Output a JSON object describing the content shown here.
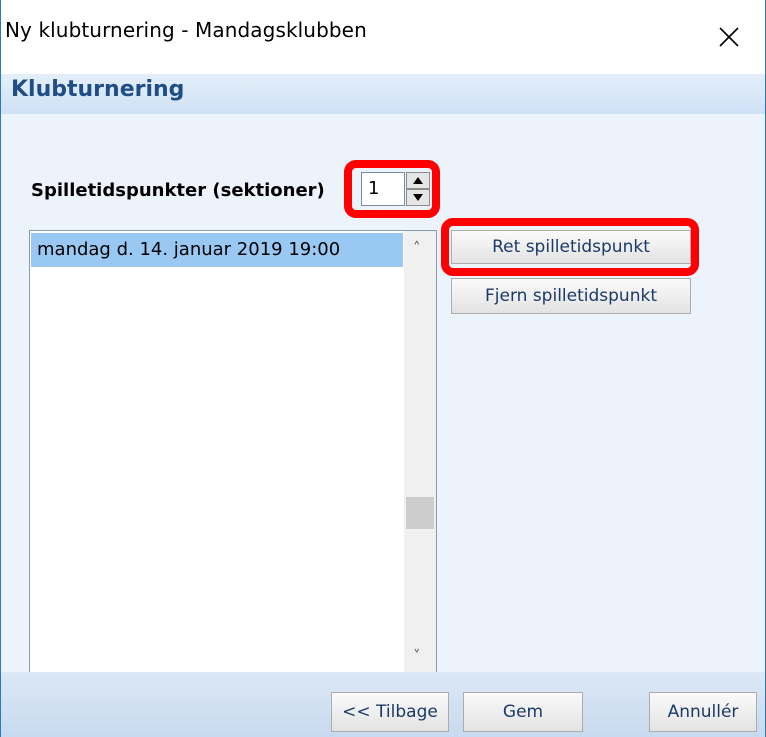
{
  "window": {
    "title": "Ny klubturnering - Mandagsklubben",
    "close_icon": "close-icon"
  },
  "header": {
    "title": "Klubturnering"
  },
  "sections": {
    "label": "Spilletidspunkter (sektioner)",
    "count": "1"
  },
  "schedule_list": {
    "items": [
      "mandag d. 14. januar 2019 19:00"
    ]
  },
  "actions": {
    "edit_label": "Ret spilletidspunkt",
    "remove_label": "Fjern spilletidspunkt"
  },
  "footer": {
    "back_label": "<< Tilbage",
    "save_label": "Gem",
    "cancel_label": "Annullér"
  },
  "colors": {
    "accent": "#1f4e86",
    "highlight": "#ff0000",
    "selection": "#99c8f3"
  }
}
